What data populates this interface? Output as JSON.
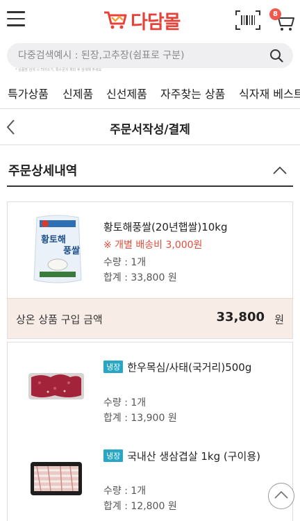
{
  "header": {
    "logo_text": "다담몰",
    "cart_count": "8"
  },
  "search": {
    "placeholder": "다중검색예시 : 된장,고추장(쉼표로 구분)",
    "note": "* 상품명 검색 시 띄어쓰기, 특수문자 제외 후 검색해 주세요"
  },
  "categories": [
    "특가상품",
    "신제품",
    "신선제품",
    "자주찾는 상품",
    "식자재 베스트"
  ],
  "page": {
    "title": "주문서작성/결제",
    "section_title": "주문상세내역"
  },
  "orders": [
    {
      "items": [
        {
          "name": "황토해풍쌀(20년햅쌀)10kg",
          "shipping_note": "※ 개별 배송비 3,000원",
          "qty": "수량 : 1개",
          "total": "합계 : 33,800 원",
          "image": "rice-bag"
        }
      ],
      "subtotal_label": "상온 상품 구입 금액",
      "subtotal_value": "33,800",
      "subtotal_unit": "원"
    },
    {
      "items": [
        {
          "badge": "냉장",
          "name": "한우목심/사태(국거리)500g",
          "qty": "수량 : 1개",
          "total": "합계 : 13,900 원",
          "image": "beef-tray"
        },
        {
          "badge": "냉장",
          "name": "국내산 생삼겹살 1kg (구이용)",
          "qty": "수량 : 1개",
          "total": "합계 : 12,800 원",
          "image": "pork-belly-tray"
        }
      ]
    }
  ],
  "colors": {
    "brand_red": "#e8413a",
    "shipping_red": "#e24b3b",
    "cold_badge": "#27a6c6",
    "subtotal_bg": "#f8ece6"
  }
}
